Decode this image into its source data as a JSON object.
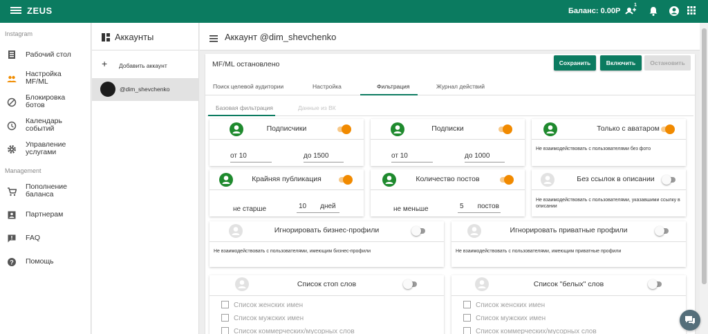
{
  "app": {
    "title": "ZEUS",
    "balance": "Баланс: 0.00Р",
    "notification_badge": "1",
    "accent": "#0b7b60"
  },
  "sidebar": {
    "section_instagram": "Instagram",
    "section_management": "Management",
    "items": [
      {
        "label1": "Рабочий стол",
        "label2": "",
        "icon": "dashboard-icon"
      },
      {
        "label1": "Настройка",
        "label2": "MF/ML",
        "icon": "people-icon"
      },
      {
        "label1": "Блокировка",
        "label2": "ботов",
        "icon": "block-icon"
      },
      {
        "label1": "Календарь",
        "label2": "событий",
        "icon": "clock-icon"
      },
      {
        "label1": "Управление",
        "label2": "услугами",
        "icon": "gear-icon"
      },
      {
        "label1": "Пополнение",
        "label2": "баланса",
        "icon": "cart-icon"
      },
      {
        "label1": "Партнерам",
        "label2": "",
        "icon": "badge-icon"
      },
      {
        "label1": "FAQ",
        "label2": "",
        "icon": "feedback-icon"
      },
      {
        "label1": "Помощь",
        "label2": "",
        "icon": "help-icon"
      }
    ]
  },
  "accounts": {
    "title": "Аккаунты",
    "add_label": "Добавить аккаунт",
    "items": [
      {
        "name": "@dim_shevchenko"
      }
    ]
  },
  "main": {
    "title": "Аккаунт @dim_shevchenko",
    "status": "MF/ML остановлено",
    "buttons": {
      "save": "Сохранить",
      "enable": "Включить",
      "stop": "Остановить"
    },
    "tabs": [
      "Поиск целевой аудитории",
      "Настройка",
      "Фильтрация",
      "Журнал действий"
    ],
    "active_tab": "Фильтрация",
    "subtabs": [
      "Базовая фильтрация",
      "Данные из ВК"
    ],
    "active_subtab": "Базовая фильтрация"
  },
  "filters": {
    "followers": {
      "title": "Подписчики",
      "on": true,
      "from_label": "от",
      "from_value": "10",
      "to_label": "до",
      "to_value": "1500"
    },
    "following": {
      "title": "Подписки",
      "on": true,
      "from_label": "от",
      "from_value": "10",
      "to_label": "до",
      "to_value": "1000"
    },
    "with_avatar": {
      "title": "Только с аватаром",
      "on": true,
      "caption": "Не взаимодействовать с пользователями без фото"
    },
    "last_post": {
      "title": "Крайняя публикация",
      "on": true,
      "prefix": "не старше",
      "value": "10",
      "unit": "дней"
    },
    "posts_count": {
      "title": "Количество постов",
      "on": true,
      "prefix": "не меньше",
      "value": "5",
      "unit": "постов"
    },
    "no_links": {
      "title": "Без ссылок в описании",
      "on": false,
      "caption": "Не взаимодействовать с пользователями, указавшими ссылку в описании"
    },
    "ignore_business": {
      "title": "Игнорировать бизнес-профили",
      "on": false,
      "caption": "Не взаимодействовать с пользователями, имеющим бизнес-профили"
    },
    "ignore_private": {
      "title": "Игнорировать приватные профили",
      "on": false,
      "caption": "Не взаимодействовать с пользователями, имеющим приватные профили"
    },
    "stop_words": {
      "title": "Список стоп слов",
      "on": false,
      "options": [
        "Список женских имен",
        "Список мужских имен",
        "Список коммерческих/мусорных слов"
      ]
    },
    "white_words": {
      "title": "Список \"белых\" слов",
      "on": false,
      "options": [
        "Список женских имен",
        "Список мужских имен",
        "Список коммерческих/мусорных слов"
      ]
    }
  }
}
